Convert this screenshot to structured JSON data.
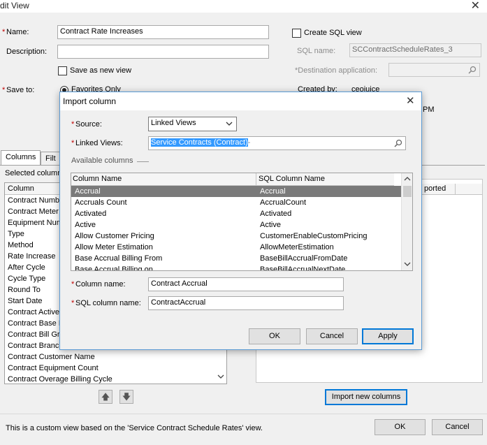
{
  "window": {
    "title": "dit View",
    "close_glyph": "✕"
  },
  "form": {
    "name_label": "Name:",
    "name_value": "Contract Rate Increases",
    "description_label": "Description:",
    "description_value": "",
    "save_as_new_label": "Save as new view",
    "save_to_label": "Save to:",
    "favorites_only_label": "Favorites Only",
    "create_sql_label": "Create SQL view",
    "sql_name_label": "SQL name:",
    "sql_name_value": "SCContractScheduleRates_3",
    "destination_label": "*Destination application:",
    "created_by_label": "Created by:",
    "created_by_value": "ceojuice",
    "created_time_fragment": "PM"
  },
  "tabs": [
    {
      "label": "Columns"
    },
    {
      "label": "Filt"
    }
  ],
  "selected_columns": {
    "label": "Selected column",
    "header": "Column",
    "items": [
      "Contract Numb",
      "Contract Meter",
      "Equipment Num",
      "Type",
      "Method",
      "Rate Increase",
      "After Cycle",
      "Cycle Type",
      "Round To",
      "Start Date",
      "Contract Active",
      "Contract Base I",
      "Contract Bill Gr",
      "Contract Branc",
      "Contract Customer Name",
      "Contract Equipment Count",
      "Contract Overage Billing Cycle"
    ]
  },
  "right_panel": {
    "header_fragment": "ported"
  },
  "buttons": {
    "import_new_columns": "Import new columns",
    "ok": "OK",
    "cancel": "Cancel",
    "move_up": "🡅",
    "move_down": "🡇"
  },
  "footer": {
    "note": "This is a custom view based on the 'Service Contract Schedule Rates' view."
  },
  "import_dialog": {
    "title": "Import column",
    "close_glyph": "✕",
    "source_label": "Source:",
    "source_value": "Linked Views",
    "linked_views_label": "Linked Views:",
    "linked_views_value": "Service Contracts (Contract)",
    "available_columns_label": "Available columns",
    "grid_headers": [
      "Column Name",
      "SQL Column Name"
    ],
    "grid_rows": [
      {
        "name": "Accrual",
        "sql": "Accrual"
      },
      {
        "name": "Accruals Count",
        "sql": "AccrualCount"
      },
      {
        "name": "Activated",
        "sql": "Activated"
      },
      {
        "name": "Active",
        "sql": "Active"
      },
      {
        "name": "Allow Customer Pricing",
        "sql": "CustomerEnableCustomPricing"
      },
      {
        "name": "Allow Meter Estimation",
        "sql": "AllowMeterEstimation"
      },
      {
        "name": "Base Accrual Billing From",
        "sql": "BaseBillAccrualFromDate"
      },
      {
        "name": "Base Accrual Billing on",
        "sql": "BaseBillAccrualNextDate"
      }
    ],
    "column_name_label": "Column name:",
    "column_name_value": "Contract Accrual",
    "sql_column_name_label": "SQL column name:",
    "sql_column_name_value": "ContractAccrual",
    "ok": "OK",
    "cancel": "Cancel",
    "apply": "Apply"
  },
  "colors": {
    "required": "#c00000",
    "accent": "#0078d7",
    "selection": "#3399ff",
    "selected_row": "#7a7a7a"
  }
}
